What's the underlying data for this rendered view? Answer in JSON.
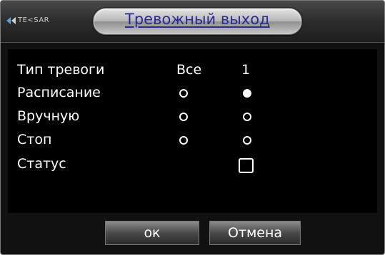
{
  "header": {
    "logo_text": "TE<SAR",
    "title": "Тревожный выход"
  },
  "form": {
    "column_labels": {
      "type": "Тип тревоги",
      "all": "Все",
      "channel": "1"
    },
    "rows": [
      {
        "label": "Расписание",
        "all_selected": false,
        "ch1_selected": true
      },
      {
        "label": "Вручную",
        "all_selected": false,
        "ch1_selected": false
      },
      {
        "label": "Стоп",
        "all_selected": false,
        "ch1_selected": false
      }
    ],
    "status": {
      "label": "Статус",
      "checked": false
    }
  },
  "buttons": {
    "ok": "ок",
    "cancel": "Отмена"
  },
  "colors": {
    "title_text": "#2a2a9a",
    "background": "#000000",
    "foreground": "#ffffff"
  }
}
